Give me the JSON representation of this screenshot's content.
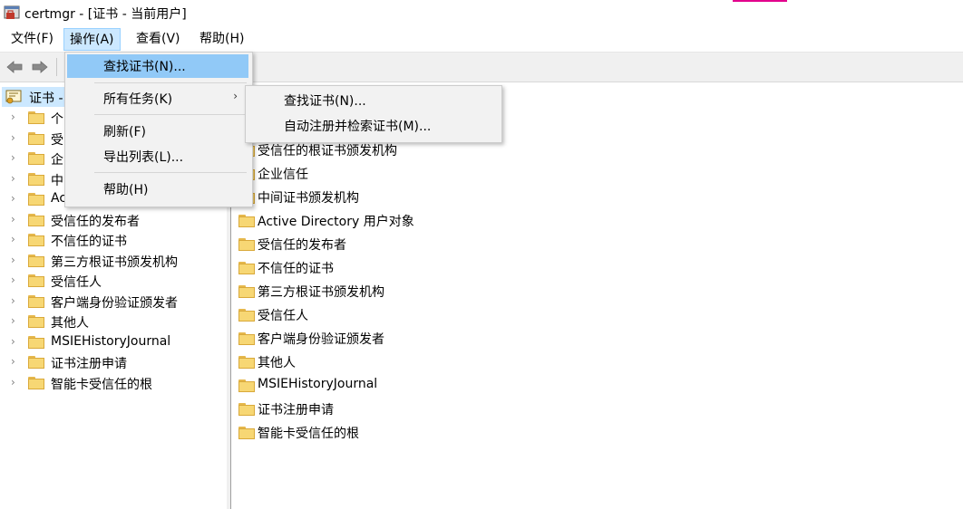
{
  "window": {
    "title": "certmgr - [证书 - 当前用户]",
    "icon": "certmgr-icon"
  },
  "menubar": {
    "items": [
      {
        "label": "文件(F)"
      },
      {
        "label": "操作(A)"
      },
      {
        "label": "查看(V)"
      },
      {
        "label": "帮助(H)"
      }
    ]
  },
  "toolbar": {
    "back_icon": "back-arrow-icon",
    "forward_icon": "forward-arrow-icon"
  },
  "tree": {
    "root_label": "证书 -",
    "nodes": [
      {
        "label": "个"
      },
      {
        "label": "受"
      },
      {
        "label": "企"
      },
      {
        "label": "中"
      },
      {
        "label": "Ac"
      },
      {
        "label": "受信任的发布者"
      },
      {
        "label": "不信任的证书"
      },
      {
        "label": "第三方根证书颁发机构"
      },
      {
        "label": "受信任人"
      },
      {
        "label": "客户端身份验证颁发者"
      },
      {
        "label": "其他人"
      },
      {
        "label": "MSIEHistoryJournal"
      },
      {
        "label": "证书注册申请"
      },
      {
        "label": "智能卡受信任的根"
      }
    ]
  },
  "list": {
    "items": [
      {
        "label": "受信任的根证书颁发机构"
      },
      {
        "label": "企业信任"
      },
      {
        "label": "中间证书颁发机构"
      },
      {
        "label": "Active Directory 用户对象"
      },
      {
        "label": "受信任的发布者"
      },
      {
        "label": "不信任的证书"
      },
      {
        "label": "第三方根证书颁发机构"
      },
      {
        "label": "受信任人"
      },
      {
        "label": "客户端身份验证颁发者"
      },
      {
        "label": "其他人"
      },
      {
        "label": "MSIEHistoryJournal"
      },
      {
        "label": "证书注册申请"
      },
      {
        "label": "智能卡受信任的根"
      }
    ]
  },
  "action_menu": {
    "find": "查找证书(N)...",
    "all_tasks": "所有任务(K)",
    "refresh": "刷新(F)",
    "export": "导出列表(L)...",
    "help": "帮助(H)",
    "submenu_arrow": "›"
  },
  "submenu": {
    "find": "查找证书(N)...",
    "auto_enroll": "自动注册并检索证书(M)..."
  },
  "colors": {
    "highlight": "#91c9f7",
    "selection": "#cce8ff",
    "folder": "#f7d774",
    "accent": "#e3008c"
  }
}
